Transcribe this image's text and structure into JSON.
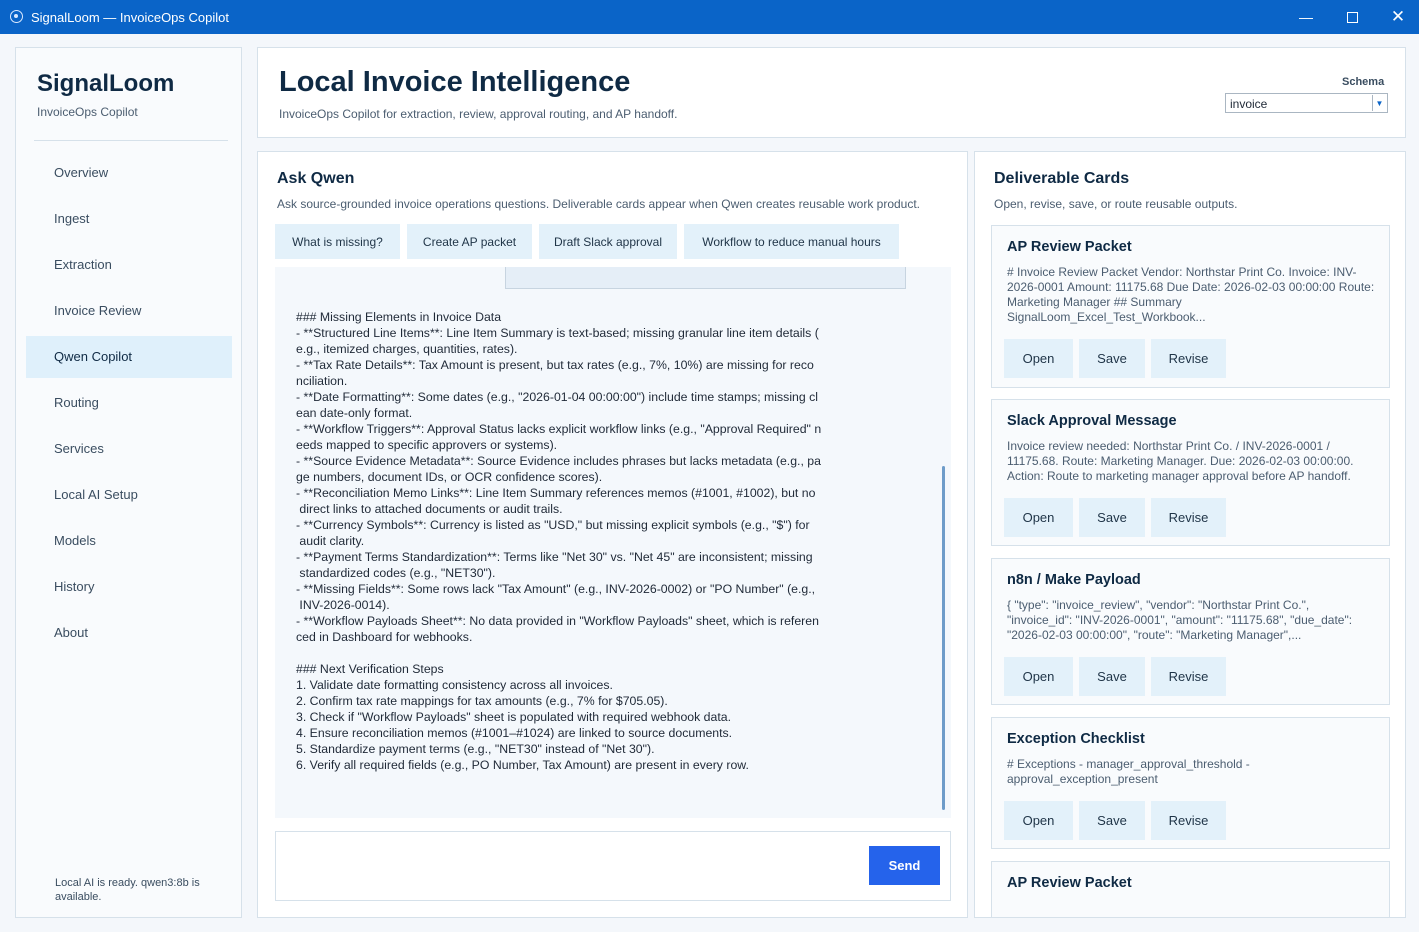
{
  "window": {
    "title": "SignalLoom — InvoiceOps Copilot",
    "controls": [
      "minimize-icon",
      "maximize-icon",
      "close-icon"
    ]
  },
  "sidebar": {
    "brand": "SignalLoom",
    "subtitle": "InvoiceOps Copilot",
    "items": [
      {
        "label": "Overview"
      },
      {
        "label": "Ingest"
      },
      {
        "label": "Extraction"
      },
      {
        "label": "Invoice Review"
      },
      {
        "label": "Qwen Copilot",
        "active": true
      },
      {
        "label": "Routing"
      },
      {
        "label": "Services"
      },
      {
        "label": "Local AI Setup"
      },
      {
        "label": "Models"
      },
      {
        "label": "History"
      },
      {
        "label": "About"
      }
    ],
    "status": "Local AI is ready. qwen3:8b is available."
  },
  "header": {
    "title": "Local Invoice Intelligence",
    "subtitle": "InvoiceOps Copilot for extraction, review, approval routing, and AP handoff.",
    "schema_label": "Schema",
    "schema_value": "invoice"
  },
  "ask": {
    "title": "Ask Qwen",
    "subtitle": "Ask source-grounded invoice operations questions. Deliverable cards appear when Qwen creates reusable work product.",
    "chips": [
      "What is missing?",
      "Create AP packet",
      "Draft Slack approval",
      "Workflow to reduce manual hours"
    ],
    "answer": "### Missing Elements in Invoice Data\n- **Structured Line Items**: Line Item Summary is text-based; missing granular line item details (\ne.g., itemized charges, quantities, rates).\n- **Tax Rate Details**: Tax Amount is present, but tax rates (e.g., 7%, 10%) are missing for reco\nnciliation.\n- **Date Formatting**: Some dates (e.g., \"2026-01-04 00:00:00\") include time stamps; missing cl\nean date-only format.\n- **Workflow Triggers**: Approval Status lacks explicit workflow links (e.g., \"Approval Required\" n\needs mapped to specific approvers or systems).\n- **Source Evidence Metadata**: Source Evidence includes phrases but lacks metadata (e.g., pa\nge numbers, document IDs, or OCR confidence scores).\n- **Reconciliation Memo Links**: Line Item Summary references memos (#1001, #1002), but no\n direct links to attached documents or audit trails.\n- **Currency Symbols**: Currency is listed as \"USD,\" but missing explicit symbols (e.g., \"$\") for\n audit clarity.\n- **Payment Terms Standardization**: Terms like \"Net 30\" vs. \"Net 45\" are inconsistent; missing\n standardized codes (e.g., \"NET30\").\n- **Missing Fields**: Some rows lack \"Tax Amount\" (e.g., INV-2026-0002) or \"PO Number\" (e.g.,\n INV-2026-0014).\n- **Workflow Payloads Sheet**: No data provided in \"Workflow Payloads\" sheet, which is referen\nced in Dashboard for webhooks.\n\n### Next Verification Steps\n1. Validate date formatting consistency across all invoices.\n2. Confirm tax rate mappings for tax amounts (e.g., 7% for $705.05).\n3. Check if \"Workflow Payloads\" sheet is populated with required webhook data.\n4. Ensure reconciliation memos (#1001–#1024) are linked to source documents.\n5. Standardize payment terms (e.g., \"NET30\" instead of \"Net 30\").\n6. Verify all required fields (e.g., PO Number, Tax Amount) are present in every row.",
    "input_value": "",
    "send_label": "Send"
  },
  "cards": {
    "title": "Deliverable Cards",
    "subtitle": "Open, revise, save, or route reusable outputs.",
    "buttons": {
      "open": "Open",
      "save": "Save",
      "revise": "Revise"
    },
    "items": [
      {
        "title": "AP Review Packet",
        "body": "# Invoice Review Packet  Vendor: Northstar Print Co. Invoice: INV-2026-0001 Amount: 11175.68 Due Date: 2026-02-03 00:00:00 Route: Marketing Manager  ## Summary SignalLoom_Excel_Test_Workbook..."
      },
      {
        "title": "Slack Approval Message",
        "body": "Invoice review needed: Northstar Print Co. / INV-2026-0001 / 11175.68. Route: Marketing Manager. Due: 2026-02-03 00:00:00. Action: Route to marketing manager approval before AP handoff."
      },
      {
        "title": "n8n / Make Payload",
        "body": "{   \"type\": \"invoice_review\",   \"vendor\": \"Northstar Print Co.\",   \"invoice_id\": \"INV-2026-0001\",   \"amount\": \"11175.68\",   \"due_date\": \"2026-02-03 00:00:00\",   \"route\": \"Marketing Manager\",..."
      },
      {
        "title": "Exception Checklist",
        "body": "# Exceptions  - manager_approval_threshold - approval_exception_present"
      },
      {
        "title": "AP Review Packet",
        "body": ""
      }
    ]
  }
}
